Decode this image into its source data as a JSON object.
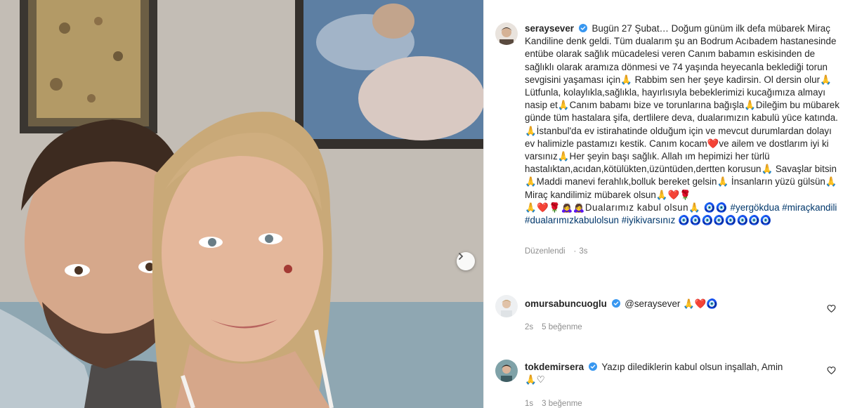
{
  "post": {
    "username": "seraysever",
    "caption": "Bugün 27 Şubat… Doğum günüm ilk defa mübarek Miraç Kandiline denk geldi. Tüm dualarım şu an Bodrum Acıbadem hastanesinde entübe olarak sağlık mücadelesi veren Canım babamın eskisinden de sağlıklı olarak aramıza dönmesi ve 74 yaşında heyecanla beklediği torun sevgisini yaşaması için🙏 Rabbim sen her şeye kadirsin. Ol dersin olur🙏Lütfunla, kolaylıkla,sağlıkla, hayırlısıyla bebeklerimizi kucağımıza almayı nasip et🙏Canım babamı bize ve torunlarına bağışla🙏Dileğim bu mübarek günde tüm hastalara şifa, dertlilere deva, dualarımızın kabulü yüce katında. 🙏İstanbul'da ev istirahatinde olduğum için ve mevcut durumlardan dolayı ev halimizle pastamızı kestik. Canım kocam❤️ve ailem ve dostlarım iyi ki varsınız🙏Her şeyin başı sağlık. Allah ım hepimizi her türlü hastalıktan,acıdan,kötülükten,üzüntüden,dertten korusun🙏 Savaşlar bitsin🙏Maddi manevi ferahlık,bolluk bereket gelsin🙏 İnsanların yüzü gülsün🙏 Miraç kandilimiz mübarek olsun🙏❤️🌹",
    "caption_emoji_line": "🙏❤️🌹🙇‍♀️🙇‍♀️Dualarımız kabul olsun🙏 🧿🧿",
    "hashtags": "#yergökdua #miraçkandili #dualarımızkabulolsun #iyikivarsınız",
    "hashtag_tail": "🧿🧿🧿🧿🧿🧿🧿🧿",
    "edited_label": "Düzenlendi",
    "edited_time": "3s"
  },
  "comments": [
    {
      "username": "omursabuncuoglu",
      "text": "@seraysever 🙏❤️🧿",
      "time": "2s",
      "likes": "5 beğenme"
    },
    {
      "username": "tokdemirsera",
      "text": "Yazıp dilediklerin kabul olsun inşallah, Amin",
      "text2": "🙏♡",
      "time": "1s",
      "likes": "3 beğenme"
    }
  ],
  "icons": {
    "next": "chevron-right-icon",
    "verified": "verified-badge-icon",
    "like": "heart-outline-icon"
  },
  "colors": {
    "verified_blue": "#3897f0",
    "hashtag_blue": "#00376b",
    "meta_gray": "#8e8e8e"
  }
}
